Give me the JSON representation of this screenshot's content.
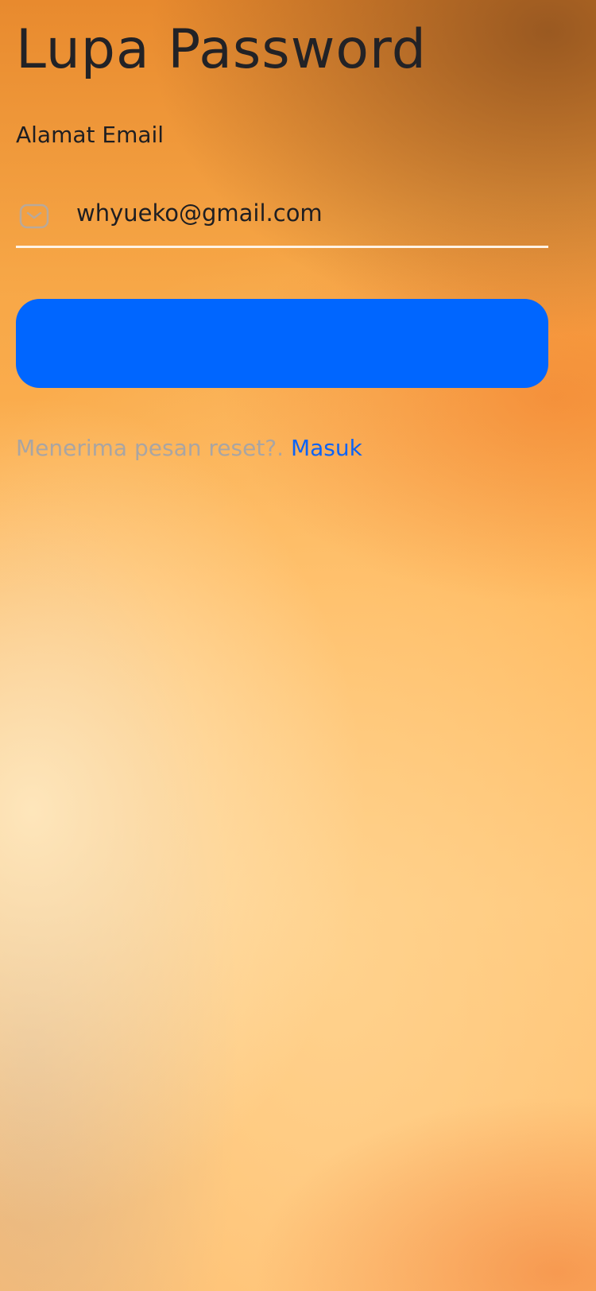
{
  "page": {
    "title": "Lupa Password"
  },
  "form": {
    "email_label": "Alamat Email",
    "email_value": "whyueko@gmail.com",
    "email_icon": "mail-icon",
    "submit_label": ""
  },
  "footer": {
    "prompt": "Menerima pesan reset?.",
    "login_link": "Masuk"
  },
  "colors": {
    "accent": "#0066ff",
    "link": "#0b63f6",
    "title_text": "#222226",
    "muted_text": "#a9a5a3",
    "underline": "#fff3e6"
  }
}
